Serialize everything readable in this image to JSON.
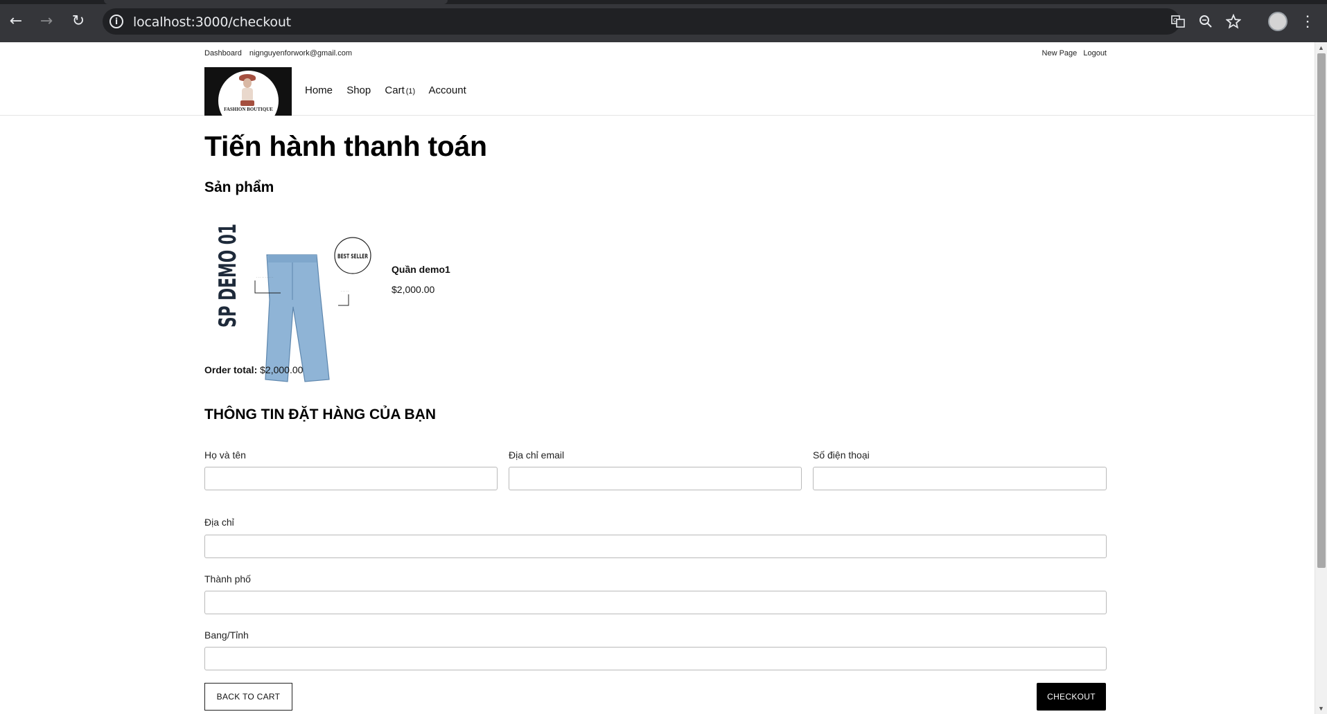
{
  "browser": {
    "url": "localhost:3000/checkout",
    "back_icon": "back-arrow-icon",
    "forward_icon": "forward-arrow-icon",
    "reload_icon": "reload-icon",
    "site_info_icon": "info-icon",
    "translate_icon": "translate-icon",
    "zoom_icon": "zoom-icon",
    "bookmark_icon": "star-icon",
    "menu_icon": "kebab-menu-icon"
  },
  "topbar": {
    "dashboard": "Dashboard",
    "email": "nignguyenforwork@gmail.com",
    "new_page": "New Page",
    "logout": "Logout"
  },
  "header": {
    "logo_text": "FASHION BOUTIQUE",
    "nav": {
      "home": "Home",
      "shop": "Shop",
      "cart": "Cart",
      "cart_count": "(1)",
      "account": "Account"
    }
  },
  "main": {
    "title": "Tiến hành thanh toán",
    "products_heading": "Sản phẩm",
    "product": {
      "image_text": "SP DEMO 01",
      "badge_text": "BEST SELLER",
      "name": "Quần demo1",
      "price": "$2,000.00"
    },
    "order_total_label": "Order total:",
    "order_total_value": "$2,000.00",
    "form_heading": "THÔNG TIN ĐẶT HÀNG CỦA BẠN",
    "form": {
      "full_name_label": "Họ và tên",
      "email_label": "Địa chỉ email",
      "phone_label": "Số điện thoại",
      "address_label": "Địa chỉ",
      "city_label": "Thành phố",
      "state_label": "Bang/Tỉnh",
      "full_name_value": "",
      "email_value": "",
      "phone_value": "",
      "address_value": "",
      "city_value": "",
      "state_value": ""
    },
    "back_button": "BACK TO CART",
    "checkout_button": "CHECKOUT"
  },
  "colors": {
    "chrome_bg": "#35363a",
    "omnibox_bg": "#202124",
    "checkout_bg": "#000000",
    "logo_bg": "#111111"
  }
}
